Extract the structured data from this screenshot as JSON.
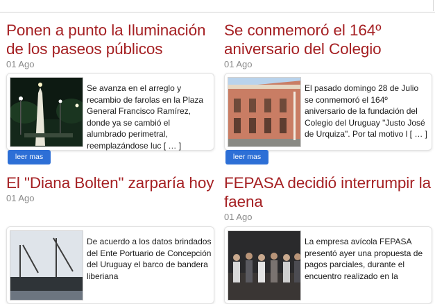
{
  "articles": [
    {
      "title": "Ponen a punto la Iluminación de los paseos públicos",
      "date": "01 Ago",
      "excerpt": "Se avanza en el arreglo y recambio de farolas en la Plaza General Francisco Ramírez, donde ya se cambió el alumbrado perimetral, reemplazándose luc [ … ]",
      "read_more": "leer mas"
    },
    {
      "title": "Se conmemoró el 164º aniversario del Colegio",
      "date": "01 Ago",
      "excerpt": "El pasado domingo 28 de Julio se conmemoró el 164º aniversario de la fundación del Colegio del Uruguay \"Justo José de Urquiza\". Por tal motivo l [ … ]",
      "read_more": "leer mas"
    },
    {
      "title": "El \"Diana Bolten\" zarparía hoy",
      "date": "01 Ago",
      "excerpt": "De acuerdo a los datos brindados del Ente Portuario de Concepción del Uruguay el barco de bandera liberiana"
    },
    {
      "title": "FEPASA decidió interrumpir la faena",
      "date": "01 Ago",
      "excerpt": "La empresa avícola FEPASA presentó ayer una propuesta de pagos parciales, durante el encuentro realizado en la"
    }
  ],
  "colors": {
    "headline": "#a52023",
    "date": "#8a8a8a",
    "button": "#2d6fd6"
  }
}
